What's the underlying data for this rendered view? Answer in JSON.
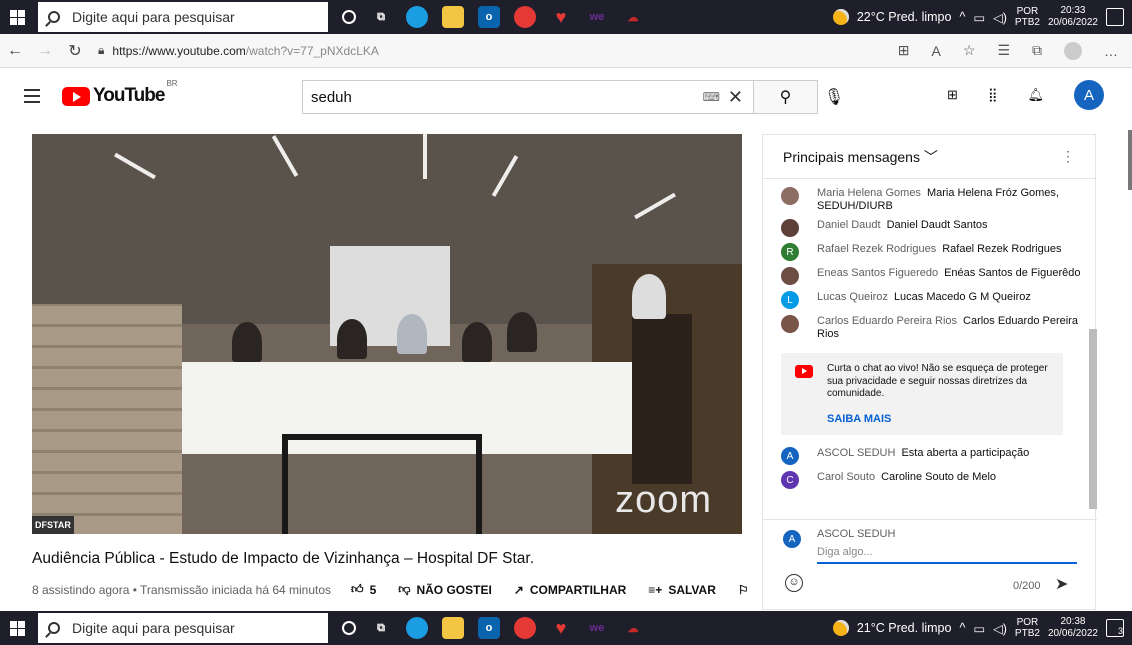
{
  "taskbar_top": {
    "search_placeholder": "Digite aqui para pesquisar",
    "weather": "22°C  Pred. limpo",
    "lang1": "POR",
    "lang2": "PTB2",
    "time": "20:33",
    "date": "20/06/2022"
  },
  "taskbar_bottom": {
    "search_placeholder": "Digite aqui para pesquisar",
    "weather": "21°C  Pred. limpo",
    "lang1": "POR",
    "lang2": "PTB2",
    "time": "20:38",
    "date": "20/06/2022",
    "notif_count": "3"
  },
  "browser": {
    "url_host": "https://www.youtube.com",
    "url_path": "/watch?v=77_pNXdcLKA"
  },
  "youtube": {
    "logo_text": "YouTube",
    "country": "BR",
    "search_value": "seduh",
    "avatar_letter": "A"
  },
  "video": {
    "overlay_brand": "zoom",
    "corner_label": "DFSTAR",
    "title": "Audiência Pública - Estudo de Impacto de Vizinhança – Hospital DF Star.",
    "meta": "8 assistindo agora • Transmissão iniciada há 64 minutos",
    "likes": "5",
    "dislike_label": "NÃO GOSTEI",
    "share_label": "COMPARTILHAR",
    "save_label": "SALVAR"
  },
  "chat": {
    "header": "Principais mensagens",
    "messages": [
      {
        "author": "Maria Helena Gomes",
        "text": "Maria Helena Fróz Gomes, SEDUH/DIURB",
        "avatar": "",
        "color": "#8d6e63"
      },
      {
        "author": "Daniel Daudt",
        "text": "Daniel Daudt Santos",
        "avatar": "",
        "color": "#5d4037"
      },
      {
        "author": "Rafael Rezek Rodrigues",
        "text": "Rafael Rezek Rodrigues",
        "avatar": "R",
        "color": "#2e7d32"
      },
      {
        "author": "Eneas Santos Figueredo",
        "text": "Enéas Santos de Figuerêdo",
        "avatar": "",
        "color": "#6d4c41"
      },
      {
        "author": "Lucas Queiroz",
        "text": "Lucas Macedo G M Queiroz",
        "avatar": "L",
        "color": "#039be5"
      },
      {
        "author": "Carlos Eduardo Pereira Rios",
        "text": "Carlos Eduardo Pereira Rios",
        "avatar": "",
        "color": "#795548"
      }
    ],
    "notice_text": "Curta o chat ao vivo! Não se esqueça de proteger sua privacidade e seguir nossas diretrizes da comunidade.",
    "notice_link": "SAIBA MAIS",
    "messages_after": [
      {
        "author": "ASCOL SEDUH",
        "text": "Esta aberta a participação",
        "avatar": "A",
        "color": "#1565c0"
      },
      {
        "author": "Carol Souto",
        "text": "Caroline Souto de Melo",
        "avatar": "C",
        "color": "#5e35b1"
      }
    ],
    "input_user": "ASCOL SEDUH",
    "input_placeholder": "Diga algo...",
    "char_count": "0/200"
  }
}
